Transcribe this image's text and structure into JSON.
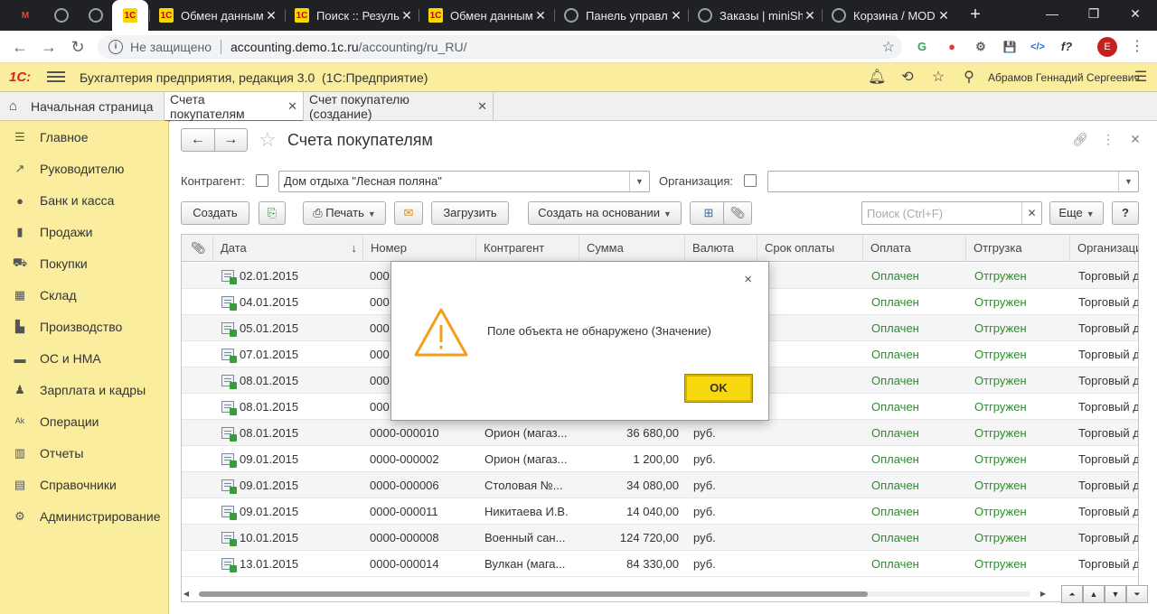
{
  "browser": {
    "tabs": [
      {
        "title": "",
        "icon": "gmail-icon",
        "active": false
      },
      {
        "title": "",
        "icon": "globe-icon",
        "active": false
      },
      {
        "title": "",
        "icon": "globe-icon",
        "active": false
      },
      {
        "title": "",
        "icon": "1c-icon",
        "active": true
      },
      {
        "title": "Обмен данным",
        "icon": "1c-icon",
        "active": false
      },
      {
        "title": "Поиск :: Резуль",
        "icon": "1c-icon",
        "active": false
      },
      {
        "title": "Обмен данным",
        "icon": "1c-icon",
        "active": false
      },
      {
        "title": "Панель управл",
        "icon": "globe-icon",
        "active": false
      },
      {
        "title": "Заказы | miniSh",
        "icon": "globe-icon",
        "active": false
      },
      {
        "title": "Корзина / MOD",
        "icon": "globe-icon",
        "active": false
      }
    ],
    "new_tab": "+",
    "window_controls": [
      "—",
      "❐",
      "✕"
    ],
    "address": {
      "security": "Не защищено",
      "host": "accounting.demo.1c.ru",
      "path": "/accounting/ru_RU/"
    },
    "profile_initial": "E",
    "extensions": [
      "G",
      "●",
      "⚙",
      "💾",
      "</>",
      "f?"
    ]
  },
  "app": {
    "logo": "1С:",
    "title": "Бухгалтерия предприятия, редакция 3.0",
    "platform": "(1С:Предприятие)",
    "user": "Абрамов Геннадий Сергеевич"
  },
  "open_windows": {
    "home": "Начальная страница",
    "tabs": [
      {
        "label": "Счета покупателям",
        "current": true
      },
      {
        "label": "Счет покупателю (создание)",
        "current": false
      }
    ]
  },
  "sidebar": {
    "items": [
      {
        "label": "Главное",
        "icon": "menu-list-icon"
      },
      {
        "label": "Руководителю",
        "icon": "trend-icon"
      },
      {
        "label": "Банк и касса",
        "icon": "coin-icon"
      },
      {
        "label": "Продажи",
        "icon": "bag-icon"
      },
      {
        "label": "Покупки",
        "icon": "cart-icon"
      },
      {
        "label": "Склад",
        "icon": "warehouse-icon"
      },
      {
        "label": "Производство",
        "icon": "factory-icon"
      },
      {
        "label": "ОС и НМА",
        "icon": "truck-icon"
      },
      {
        "label": "Зарплата и кадры",
        "icon": "person-icon"
      },
      {
        "label": "Операции",
        "icon": "operations-icon"
      },
      {
        "label": "Отчеты",
        "icon": "bar-chart-icon"
      },
      {
        "label": "Справочники",
        "icon": "book-icon"
      },
      {
        "label": "Администрирование",
        "icon": "gear-icon"
      }
    ]
  },
  "form": {
    "title": "Счета покупателям",
    "filters": {
      "counterparty_label": "Контрагент:",
      "counterparty_value": "Дом отдыха \"Лесная поляна\"",
      "organization_label": "Организация:",
      "organization_value": ""
    },
    "toolbar": {
      "create": "Создать",
      "print": "Печать",
      "load": "Загрузить",
      "create_based_on": "Создать на основании",
      "search_placeholder": "Поиск (Ctrl+F)",
      "more": "Еще",
      "help": "?"
    },
    "columns": [
      "Дата",
      "Номер",
      "Контрагент",
      "Сумма",
      "Валюта",
      "Срок оплаты",
      "Оплата",
      "Отгрузка",
      "Организаци"
    ],
    "rows": [
      {
        "date": "02.01.2015",
        "number": "000",
        "counterparty": "",
        "sum": "",
        "currency": "",
        "due": "",
        "payment": "Оплачен",
        "shipment": "Отгружен",
        "org": "Торговый д"
      },
      {
        "date": "04.01.2015",
        "number": "000",
        "counterparty": "",
        "sum": "",
        "currency": "",
        "due": "",
        "payment": "Оплачен",
        "shipment": "Отгружен",
        "org": "Торговый д"
      },
      {
        "date": "05.01.2015",
        "number": "000",
        "counterparty": "",
        "sum": "",
        "currency": "",
        "due": "",
        "payment": "Оплачен",
        "shipment": "Отгружен",
        "org": "Торговый д"
      },
      {
        "date": "07.01.2015",
        "number": "000",
        "counterparty": "",
        "sum": "",
        "currency": "",
        "due": "",
        "payment": "Оплачен",
        "shipment": "Отгружен",
        "org": "Торговый д"
      },
      {
        "date": "08.01.2015",
        "number": "000",
        "counterparty": "",
        "sum": "",
        "currency": "",
        "due": "",
        "payment": "Оплачен",
        "shipment": "Отгружен",
        "org": "Торговый д"
      },
      {
        "date": "08.01.2015",
        "number": "000",
        "counterparty": "",
        "sum": "",
        "currency": "",
        "due": "",
        "payment": "Оплачен",
        "shipment": "Отгружен",
        "org": "Торговый д"
      },
      {
        "date": "08.01.2015",
        "number": "0000-000010",
        "counterparty": "Орион (магаз...",
        "sum": "36 680,00",
        "currency": "руб.",
        "due": "",
        "payment": "Оплачен",
        "shipment": "Отгружен",
        "org": "Торговый д"
      },
      {
        "date": "09.01.2015",
        "number": "0000-000002",
        "counterparty": "Орион (магаз...",
        "sum": "1 200,00",
        "currency": "руб.",
        "due": "",
        "payment": "Оплачен",
        "shipment": "Отгружен",
        "org": "Торговый д"
      },
      {
        "date": "09.01.2015",
        "number": "0000-000006",
        "counterparty": "Столовая №...",
        "sum": "34 080,00",
        "currency": "руб.",
        "due": "",
        "payment": "Оплачен",
        "shipment": "Отгружен",
        "org": "Торговый д"
      },
      {
        "date": "09.01.2015",
        "number": "0000-000011",
        "counterparty": "Никитаева И.В.",
        "sum": "14 040,00",
        "currency": "руб.",
        "due": "",
        "payment": "Оплачен",
        "shipment": "Отгружен",
        "org": "Торговый д"
      },
      {
        "date": "10.01.2015",
        "number": "0000-000008",
        "counterparty": "Военный сан...",
        "sum": "124 720,00",
        "currency": "руб.",
        "due": "",
        "payment": "Оплачен",
        "shipment": "Отгружен",
        "org": "Торговый д"
      },
      {
        "date": "13.01.2015",
        "number": "0000-000014",
        "counterparty": "Вулкан (мага...",
        "sum": "84 330,00",
        "currency": "руб.",
        "due": "",
        "payment": "Оплачен",
        "shipment": "Отгружен",
        "org": "Торговый д"
      }
    ]
  },
  "dialog": {
    "message": "Поле объекта не обнаружено (Значение)",
    "ok": "OK",
    "close": "×"
  },
  "colors": {
    "accent_yellow": "#fbed9e",
    "ok_yellow": "#f8d90f",
    "status_green": "#2e8b2e",
    "warning_orange": "#f2a01c"
  }
}
